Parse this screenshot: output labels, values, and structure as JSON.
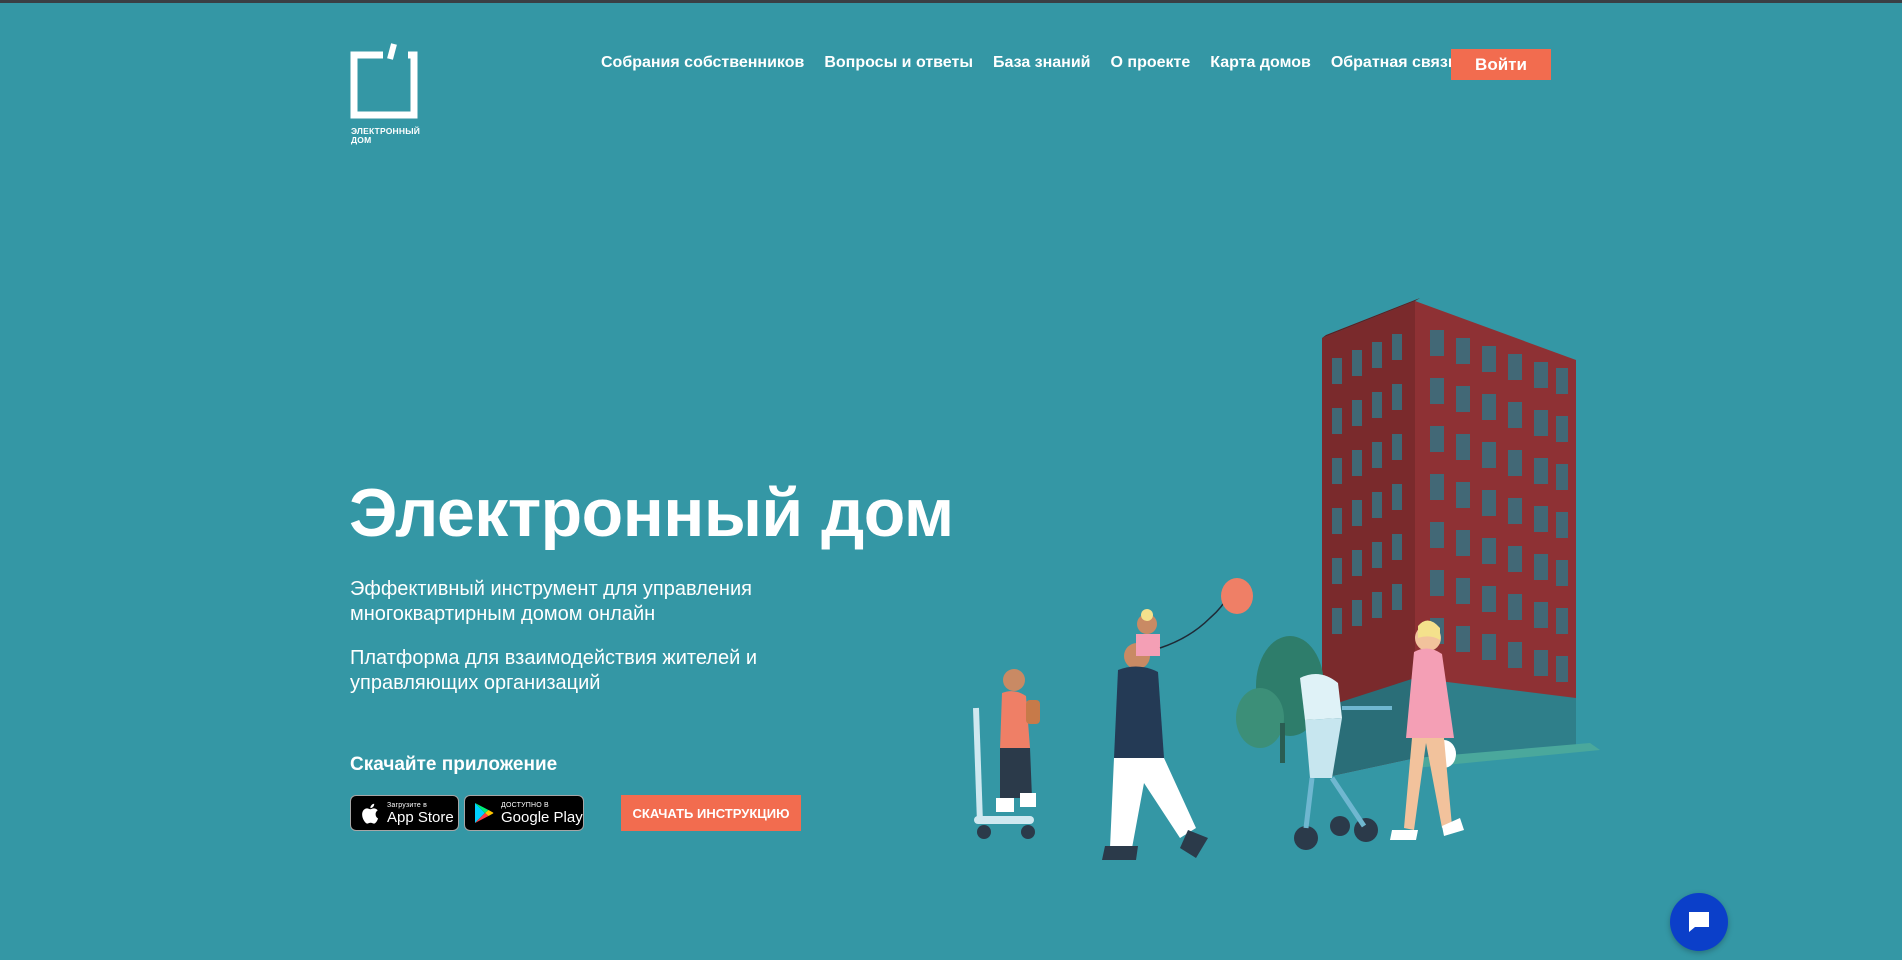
{
  "brand": {
    "logo_text": "ЭЛЕКТРОННЫЙ\nДОМ",
    "accent_color": "#f26c4f",
    "background_color": "#3497a5",
    "chat_color": "#0b3fc9"
  },
  "nav": {
    "items": [
      {
        "label": "Собрания собственников"
      },
      {
        "label": "Вопросы и ответы"
      },
      {
        "label": "База знаний"
      },
      {
        "label": "О проекте"
      },
      {
        "label": "Карта домов"
      },
      {
        "label": "Обратная связь"
      }
    ],
    "login_label": "Войти"
  },
  "hero": {
    "title": "Электронный дом",
    "paragraph_1": "Эффективный инструмент для управления многоквартирным домом онлайн",
    "paragraph_2": "Платформа для взаимодействия жителей и управляющих организаций",
    "download_label": "Скачайте приложение",
    "appstore": {
      "small": "Загрузите в",
      "big": "App Store",
      "icon": "apple-icon"
    },
    "googleplay": {
      "small": "ДОСТУПНО В",
      "big": "Google Play",
      "icon": "google-play-icon"
    },
    "instruction_button": "СКАЧАТЬ ИНСТРУКЦИЮ"
  },
  "chat": {
    "icon": "chat-bubble-icon"
  }
}
